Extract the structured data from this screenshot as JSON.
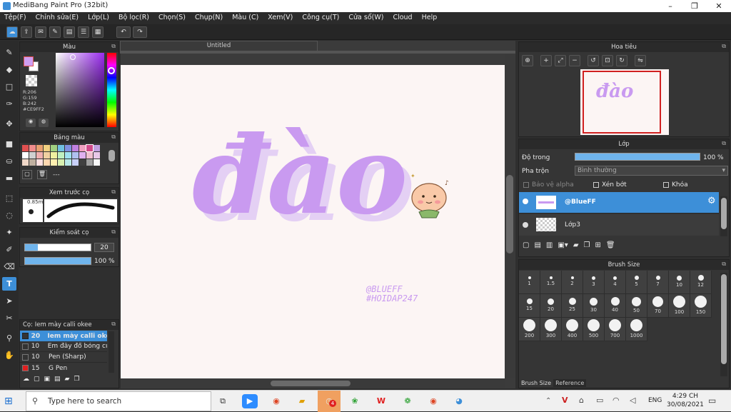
{
  "window": {
    "title": "MediBang Paint Pro (32bit)",
    "minimize": "–",
    "maximize": "❐",
    "close": "✕"
  },
  "menu": [
    "Tệp(F)",
    "Chỉnh sửa(E)",
    "Lớp(L)",
    "Bộ lọc(R)",
    "Chọn(S)",
    "Chụp(N)",
    "Màu (C)",
    "Xem(V)",
    "Công cụ(T)",
    "Cửa sổ(W)",
    "Cloud",
    "Help"
  ],
  "canvas": {
    "tab": "Untitled",
    "artwork_text": "đào",
    "watermark_line1": "@BLUEFF",
    "watermark_line2": "#HOIDAP247"
  },
  "panels": {
    "color": {
      "title": "Màu",
      "r": "R:206",
      "g": "G:159",
      "b": "B:242",
      "hex": "#CE9FF2"
    },
    "palette": {
      "title": "Bảng màu",
      "label": "---"
    },
    "brush_preview": {
      "title": "Xem trước cọ",
      "size": "0.85m"
    },
    "brush_control": {
      "title": "Kiểm soát cọ",
      "size_value": "20",
      "opacity_value": "100 %",
      "size_fraction": 0.2,
      "opacity_fraction": 1.0
    },
    "brush_list": {
      "title": "Cọ: Iem mày calli okee",
      "items": [
        {
          "size": "20",
          "name": "Iem mày calli oke",
          "color": "#333333",
          "selected": true
        },
        {
          "size": "10",
          "name": "Em đây đổ bóng cu",
          "color": "#333333",
          "selected": false
        },
        {
          "size": "10",
          "name": "Pen (Sharp)",
          "color": "#333333",
          "selected": false
        },
        {
          "size": "15",
          "name": "G Pen",
          "color": "#e02020",
          "selected": false
        }
      ]
    },
    "navigator": {
      "title": "Hoa tiêu",
      "thumb_text": "đào"
    },
    "layers": {
      "title": "Lớp",
      "opacity_label": "Độ trong",
      "opacity_value": "100 %",
      "blend_label": "Pha trộn",
      "blend_value": "Bình thường",
      "protect_alpha": "Bảo vệ alpha",
      "clipping": "Xén bớt",
      "lock": "Khóa",
      "items": [
        {
          "name": "@BlueFF",
          "selected": true
        },
        {
          "name": "Lớp3",
          "selected": false
        }
      ]
    },
    "brush_size": {
      "title": "Brush Size",
      "sizes": [
        "1",
        "1.5",
        "2",
        "3",
        "4",
        "5",
        "7",
        "10",
        "12",
        "15",
        "20",
        "25",
        "30",
        "40",
        "50",
        "70",
        "100",
        "150",
        "200",
        "300",
        "400",
        "500",
        "700",
        "1000"
      ],
      "tabs": [
        "Brush Size",
        "Reference"
      ]
    }
  },
  "taskbar": {
    "search_placeholder": "Type here to search",
    "lang": "ENG",
    "time": "4:29 CH",
    "date": "30/08/2021",
    "badge": "4"
  },
  "colors": {
    "primary": "#CE9FF2",
    "secondary": "#ffffff",
    "lavender": "#c99af0",
    "accent_blue": "#3d8fd8"
  }
}
